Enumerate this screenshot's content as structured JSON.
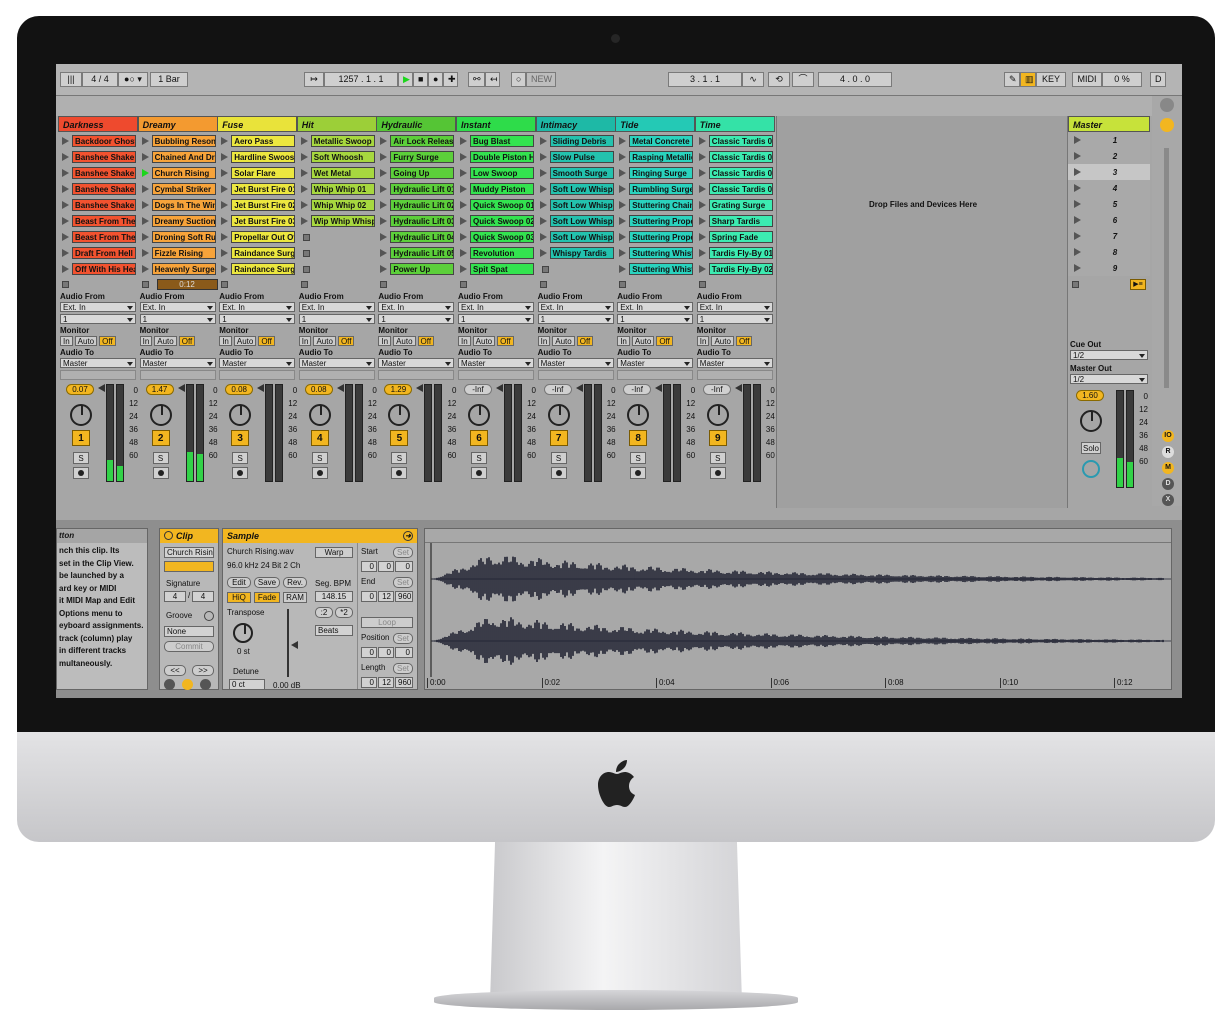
{
  "toolbar": {
    "sig": "4 / 4",
    "quant": "1 Bar",
    "bpm": "1257 .  1 .  1",
    "new": "NEW",
    "pos": "3 .  1 .  1",
    "len": "4 .  0 .  0",
    "key": "KEY",
    "midi": "MIDI",
    "cpu": "0 %",
    "d": "D"
  },
  "tracks": [
    {
      "name": "Darkness",
      "color": "#ee4a2e",
      "clipColor": "#f2522f",
      "clips": [
        "Backdoor Ghost",
        "Banshee Shake",
        "Banshee Shake",
        "Banshee Shake",
        "Banshee Shake",
        "Beast From The",
        "Beast From The",
        "Draft From Hell",
        "Off With His Hea"
      ],
      "vol": "0.07",
      "num": "1",
      "m1": 22,
      "m2": 16,
      "play": -1
    },
    {
      "name": "Dreamy",
      "color": "#f39a30",
      "clipColor": "#f7a33a",
      "clips": [
        "Bubbling Reson",
        "Chained And Dr",
        "Church Rising",
        "Cymbal Striker",
        "Dogs In The Win",
        "Dreamy Suction",
        "Droning Soft Ru",
        "Fizzle Rising",
        "Heavenly Surge"
      ],
      "vol": "1.47",
      "num": "2",
      "m1": 30,
      "m2": 28,
      "play": 2
    },
    {
      "name": "Fuse",
      "color": "#e9e33a",
      "clipColor": "#ece73f",
      "clips": [
        "Aero Pass",
        "Hardline Swoosh",
        "Solar Flare",
        "Jet Burst Fire 01",
        "Jet Burst Fire 02",
        "Jet Burst Fire 03",
        "Propellar Out Of",
        "Raindance Surge",
        "Raindance Surge"
      ],
      "vol": "0.08",
      "num": "3",
      "m1": 0,
      "m2": 0,
      "play": -1
    },
    {
      "name": "Hit",
      "color": "#9ccf38",
      "clipColor": "#a7d83f",
      "clips": [
        "Metallic Swoop",
        "Soft Whoosh",
        "Wet Metal",
        "Whip Whip 01",
        "Whip Whip 02",
        "Wip Whip Whisp",
        "",
        "",
        ""
      ],
      "vol": "0.08",
      "num": "4",
      "m1": 0,
      "m2": 0,
      "play": -1
    },
    {
      "name": "Hydraulic",
      "color": "#55c535",
      "clipColor": "#5ccf3a",
      "clips": [
        "Air Lock Releas",
        "Furry Surge",
        "Going Up",
        "Hydraulic Lift 01",
        "Hydraulic Lift 02",
        "Hydraulic Lift 03",
        "Hydraulic Lift 04",
        "Hydraulic Lift 05",
        "Power Up"
      ],
      "vol": "1.29",
      "num": "5",
      "m1": 0,
      "m2": 0,
      "play": -1
    },
    {
      "name": "Instant",
      "color": "#2edc4a",
      "clipColor": "#33e34f",
      "clips": [
        "Bug Blast",
        "Double Piston H",
        "Low Swoop",
        "Muddy Piston",
        "Quick Swoop 01",
        "Quick Swoop 02",
        "Quick Swoop 03",
        "Revolution",
        "Spit Spat"
      ],
      "vol": "-Inf",
      "num": "6",
      "m1": 0,
      "m2": 0,
      "play": -1
    },
    {
      "name": "Intimacy",
      "color": "#1eb9a6",
      "clipColor": "#23c2ae",
      "clips": [
        "Sliding Debris",
        "Slow Pulse",
        "Smooth Surge",
        "Soft Low Whisp",
        "Soft Low Whisp",
        "Soft Low Whisp",
        "Soft Low Whisp",
        "Whispy Tardis",
        ""
      ],
      "vol": "-Inf",
      "num": "7",
      "m1": 0,
      "m2": 0,
      "play": -1
    },
    {
      "name": "Tide",
      "color": "#24c9b5",
      "clipColor": "#2ad3be",
      "clips": [
        "Metal Concrete",
        "Rasping Metallic",
        "Ringing Surge",
        "Rumbling Surge",
        "Stuttering Chain",
        "Stuttering Prope",
        "Stuttering Prope",
        "Stuttering Whist",
        "Stuttering Whist"
      ],
      "vol": "-Inf",
      "num": "8",
      "m1": 0,
      "m2": 0,
      "play": -1
    },
    {
      "name": "Time",
      "color": "#34e2a7",
      "clipColor": "#3cebb1",
      "clips": [
        "Classic Tardis 0",
        "Classic Tardis 0",
        "Classic Tardis 0",
        "Classic Tardis 0",
        "Grating Surge",
        "Sharp Tardis",
        "Spring Fade",
        "Tardis Fly-By 01",
        "Tardis Fly-By 02"
      ],
      "vol": "-Inf",
      "num": "9",
      "m1": 0,
      "m2": 0,
      "play": -1
    }
  ],
  "io": {
    "audio_from": "Audio From",
    "ext_in": "Ext. In",
    "ch": "1",
    "monitor": "Monitor",
    "in": "In",
    "auto": "Auto",
    "off": "Off",
    "audio_to": "Audio To",
    "master": "Master",
    "scale": [
      "0",
      "12",
      "24",
      "36",
      "48",
      "60"
    ],
    "cue_out": "Cue Out",
    "cue_val": "1/2",
    "master_out": "Master Out",
    "master_val": "1/2",
    "solo": "Solo",
    "timer": "0:12"
  },
  "drop_text": "Drop Files and Devices Here",
  "master": {
    "name": "Master",
    "scenes": [
      "1",
      "2",
      "3",
      "4",
      "5",
      "6",
      "7",
      "8",
      "9"
    ],
    "vol": "1.60"
  },
  "help": {
    "title": "tton",
    "lines": [
      "nch this clip. Its",
      "set in the Clip View.",
      "be launched by a",
      "ard key or MIDI",
      "it MIDI Map and Edit",
      "Options menu to",
      "eyboard assignments.",
      "track (column) play",
      "in different tracks",
      "multaneously."
    ]
  },
  "clip": {
    "title": "Clip",
    "name": "Church Risin",
    "signature": "Signature",
    "sig_n": "4",
    "sig_d": "4",
    "groove": "Groove",
    "groove_val": "None",
    "commit": "Commit"
  },
  "sample": {
    "title": "Sample",
    "file": "Church Rising.wav",
    "info": "96.0 kHz 24 Bit 2 Ch",
    "warp": "Warp",
    "edit": "Edit",
    "save": "Save",
    "rev": "Rev.",
    "hiq": "HiQ",
    "fade": "Fade",
    "ram": "RAM",
    "transpose": "Transpose",
    "st": "0 st",
    "detune": "Detune",
    "ct": "0 ct",
    "db": "0.00 dB",
    "seg_bpm": "Seg. BPM",
    "bpm_val": "148.15",
    "half": ":2",
    "dbl": "*2",
    "beats": "Beats",
    "start": "Start",
    "end": "End",
    "loop": "Loop",
    "position": "Position",
    "length": "Length",
    "set": "Set",
    "start_v": [
      "0",
      "0",
      "0"
    ],
    "end_v": [
      "0",
      "12",
      "960"
    ],
    "pos_v": [
      "0",
      "0",
      "0"
    ],
    "len_v": [
      "0",
      "12",
      "960"
    ]
  },
  "ruler": [
    "0:00",
    "0:02",
    "0:04",
    "0:06",
    "0:08",
    "0:10",
    "0:12"
  ],
  "right_dots": [
    "IO",
    "R",
    "M",
    "D",
    "X"
  ]
}
